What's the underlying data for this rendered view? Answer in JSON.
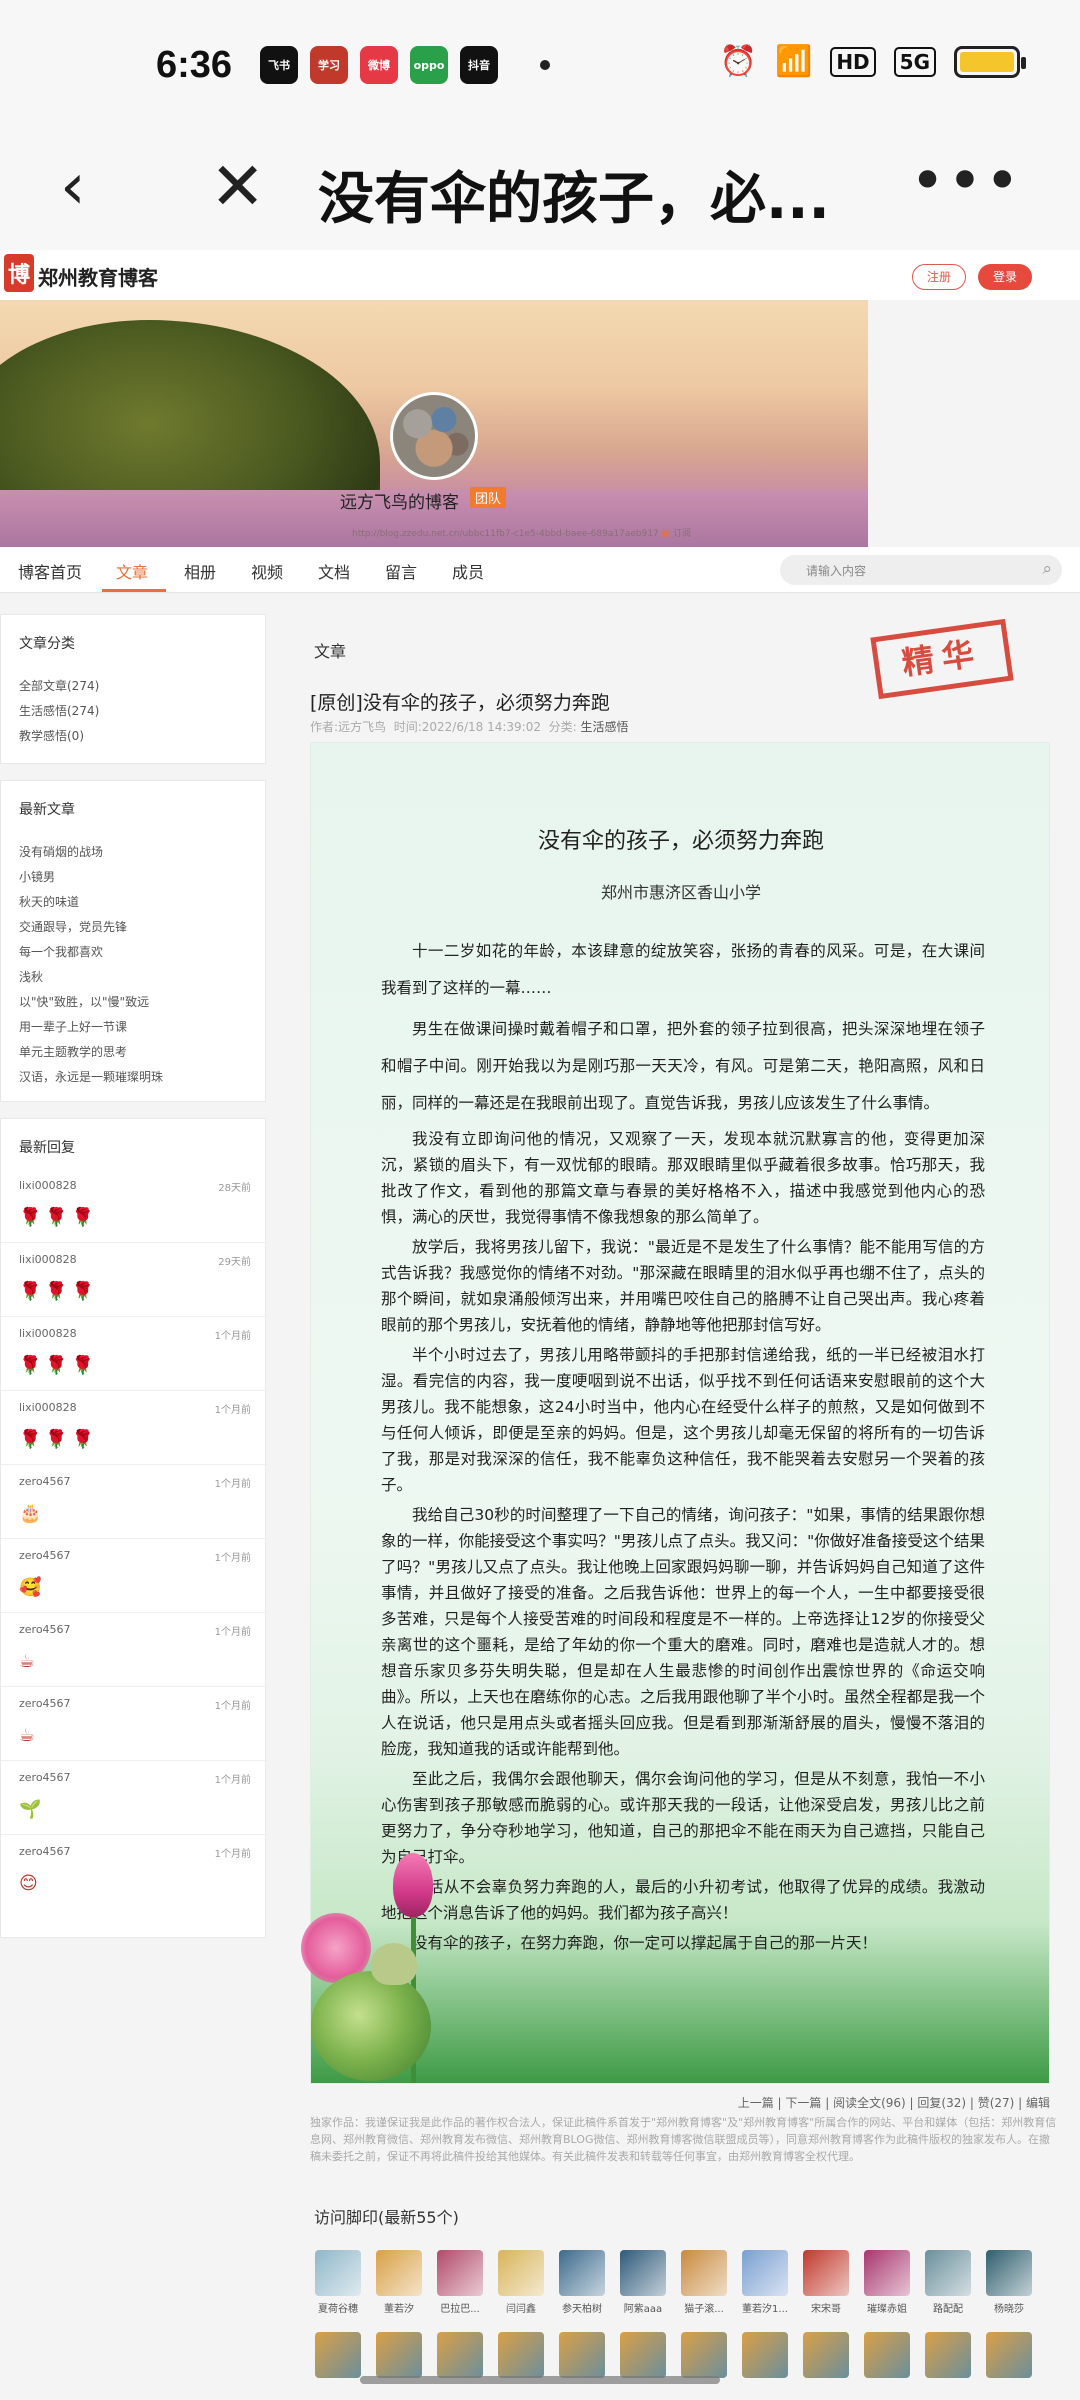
{
  "status": {
    "time": "6:36",
    "apps": [
      {
        "name": "飞书",
        "color": "#111111"
      },
      {
        "name": "学习",
        "color": "#c0392b"
      },
      {
        "name": "微博",
        "color": "#e63946"
      },
      {
        "name": "oppo",
        "color": "#2ba04a"
      },
      {
        "name": "抖音",
        "color": "#111111"
      }
    ],
    "network": "HD",
    "signal": "5G"
  },
  "nav": {
    "title": "没有伞的孩子，必...",
    "back_icon": "‹",
    "close_icon": "✕",
    "more_icon": "•••"
  },
  "site": {
    "name": "郑州教育博客",
    "logo_glyph": "博",
    "register": "注册",
    "login": "登录"
  },
  "banner": {
    "blog_name": "远方飞鸟的博客",
    "badge": "团队",
    "url": "http://blog.zzedu.net.cn/ubbc11fb7-c1e5-4bbd-baee-689a17aeb917",
    "subscribe": "订阅"
  },
  "tabs": [
    "博客首页",
    "文章",
    "相册",
    "视频",
    "文档",
    "留言",
    "成员"
  ],
  "active_tab": "文章",
  "search": {
    "placeholder": "请输入内容"
  },
  "sidebar": {
    "category_title": "文章分类",
    "categories": [
      "全部文章(274)",
      "生活感悟(274)",
      "教学感悟(0)"
    ],
    "recent_title": "最新文章",
    "recent": [
      "没有硝烟的战场",
      "小镜男",
      "秋天的味道",
      "交通跟导，党员先锋",
      "每一个我都喜欢",
      "浅秋",
      "以\"快\"致胜，以\"慢\"致远",
      "用一辈子上好一节课",
      "单元主题教学的思考",
      "汉语，永远是一颗璀璨明珠"
    ],
    "replies_title": "最新回复",
    "replies": [
      {
        "user": "lixi000828",
        "time": "28天前",
        "emoji": "🌹🌹🌹"
      },
      {
        "user": "lixi000828",
        "time": "29天前",
        "emoji": "🌹🌹🌹"
      },
      {
        "user": "lixi000828",
        "time": "1个月前",
        "emoji": "🌹🌹🌹"
      },
      {
        "user": "lixi000828",
        "time": "1个月前",
        "emoji": "🌹🌹🌹"
      },
      {
        "user": "zero4567",
        "time": "1个月前",
        "emoji": "🎂"
      },
      {
        "user": "zero4567",
        "time": "1个月前",
        "emoji": "🥰"
      },
      {
        "user": "zero4567",
        "time": "1个月前",
        "emoji": "☕"
      },
      {
        "user": "zero4567",
        "time": "1个月前",
        "emoji": "☕"
      },
      {
        "user": "zero4567",
        "time": "1个月前",
        "emoji": "🌱"
      },
      {
        "user": "zero4567",
        "time": "1个月前",
        "emoji": "😊"
      }
    ]
  },
  "article": {
    "section_label": "文章",
    "title": "[原创]没有伞的孩子，必须努力奔跑",
    "meta_author": "作者:远方飞鸟",
    "meta_time": "时间:2022/6/18 14:39:02",
    "meta_cat_label": "分类:",
    "meta_cat": "生活感悟",
    "stamp": "精华",
    "content_title": "没有伞的孩子，必须努力奔跑",
    "school": "郑州市惠济区香山小学",
    "paragraphs": [
      "十一二岁如花的年龄，本该肆意的绽放笑容，张扬的青春的风采。可是，在大课间我看到了这样的一幕……",
      "男生在做课间操时戴着帽子和口罩，把外套的领子拉到很高，把头深深地埋在领子和帽子中间。刚开始我以为是刚巧那一天天冷，有风。可是第二天，艳阳高照，风和日丽，同样的一幕还是在我眼前出现了。直觉告诉我，男孩儿应该发生了什么事情。",
      "我没有立即询问他的情况，又观察了一天，发现本就沉默寡言的他，变得更加深沉，紧锁的眉头下，有一双忧郁的眼睛。那双眼睛里似乎藏着很多故事。恰巧那天，我批改了作文，看到他的那篇文章与春景的美好格格不入，描述中我感觉到他内心的恐惧，满心的厌世，我觉得事情不像我想象的那么简单了。",
      "放学后，我将男孩儿留下，我说：\"最近是不是发生了什么事情？能不能用写信的方式告诉我？我感觉你的情绪不对劲。\"那深藏在眼睛里的泪水似乎再也绷不住了，点头的那个瞬间，就如泉涌般倾泻出来，并用嘴巴咬住自己的胳膊不让自己哭出声。我心疼着眼前的那个男孩儿，安抚着他的情绪，静静地等他把那封信写好。",
      "半个小时过去了，男孩儿用略带颤抖的手把那封信递给我，纸的一半已经被泪水打湿。看完信的内容，我一度哽咽到说不出话，似乎找不到任何话语来安慰眼前的这个大男孩儿。我不能想象，这24小时当中，他内心在经受什么样子的煎熬，又是如何做到不与任何人倾诉，即便是至亲的妈妈。但是，这个男孩儿却毫无保留的将所有的一切告诉了我，那是对我深深的信任，我不能辜负这种信任，我不能哭着去安慰另一个哭着的孩子。",
      "我给自己30秒的时间整理了一下自己的情绪，询问孩子：\"如果，事情的结果跟你想象的一样，你能接受这个事实吗？\"男孩儿点了点头。我又问：\"你做好准备接受这个结果了吗？\"男孩儿又点了点头。我让他晚上回家跟妈妈聊一聊，并告诉妈妈自己知道了这件事情，并且做好了接受的准备。之后我告诉他：世界上的每一个人，一生中都要接受很多苦难，只是每个人接受苦难的时间段和程度是不一样的。上帝选择让12岁的你接受父亲离世的这个噩耗，是给了年幼的你一个重大的磨难。同时，磨难也是造就人才的。想想音乐家贝多芬失明失聪，但是却在人生最悲惨的时间创作出震惊世界的《命运交响曲》。所以，上天也在磨练你的心志。之后我用跟他聊了半个小时。虽然全程都是我一个人在说话，他只是用点头或者摇头回应我。但是看到那渐渐舒展的眉头，慢慢不落泪的脸庞，我知道我的话或许能帮到他。",
      "至此之后，我偶尔会跟他聊天，偶尔会询问他的学习，但是从不刻意，我怕一不小心伤害到孩子那敏感而脆弱的心。或许那天我的一段话，让他深受启发，男孩儿比之前更努力了，争分夺秒地学习，他知道，自己的那把伞不能在雨天为自己遮挡，只能自己为自己打伞。",
      "生活从不会辜负努力奔跑的人，最后的小升初考试，他取得了优异的成绩。我激动地把这个消息告诉了他的妈妈。我们都为孩子高兴！",
      "没有伞的孩子，在努力奔跑，你一定可以撑起属于自己的那一片天！"
    ],
    "actions": "上一篇 | 下一篇 | 阅读全文(96) | 回复(32) | 赞(27) | 编辑",
    "copyright": "独家作品：我谨保证我是此作品的著作权合法人，保证此稿件系首发于\"郑州教育博客\"及\"郑州教育博客\"所属合作的网站、平台和媒体（包括：郑州教育信息网、郑州教育微信、郑州教育发布微信、郑州教育BLOG微信、郑州教育博客微信联盟成员等），同意郑州教育博客作为此稿件版权的独家发布人。在撤稿未委托之前，保证不再将此稿件投给其他媒体。有关此稿件发表和转载等任何事宜，由郑州教育博客全权代理。"
  },
  "footprint": {
    "title": "访问脚印(最新55个)",
    "visitors": [
      {
        "name": "夏荷谷穗",
        "color": "#8fb7c9"
      },
      {
        "name": "董若汐",
        "color": "#d9a046"
      },
      {
        "name": "巴拉巴...",
        "color": "#b24a6a"
      },
      {
        "name": "闫闫鑫",
        "color": "#d8b45a"
      },
      {
        "name": "参天柏树",
        "color": "#3d6b8c"
      },
      {
        "name": "阿紫aaa",
        "color": "#2e5a7a"
      },
      {
        "name": "猫子滚...",
        "color": "#c98a3e"
      },
      {
        "name": "董若汐1...",
        "color": "#7a9fd1"
      },
      {
        "name": "宋宋哥",
        "color": "#c0392b"
      },
      {
        "name": "璀璨赤姐",
        "color": "#a8366e"
      },
      {
        "name": "路配配",
        "color": "#6a8f9c"
      },
      {
        "name": "杨晓莎",
        "color": "#2f5f6e"
      }
    ]
  }
}
